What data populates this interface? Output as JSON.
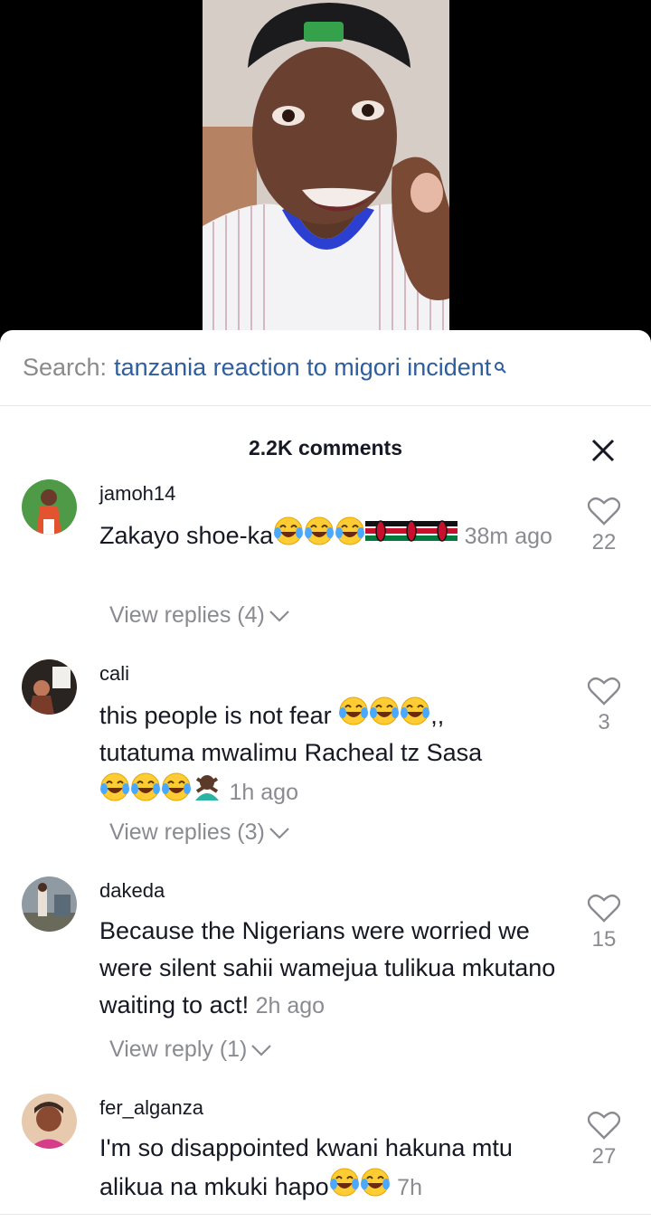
{
  "search": {
    "prefix": "Search:",
    "query": "tanzania reaction to migori incident"
  },
  "comments_header": "2.2K comments",
  "colors": {
    "accent_link": "#2f5e9e",
    "muted": "#8a8b91",
    "text": "#161823"
  },
  "comments": [
    {
      "username": "jamoh14",
      "text": "Zakayo shoe-ka",
      "emojis": [
        "laughing-tears",
        "laughing-tears",
        "laughing-tears",
        "kenya-flag",
        "kenya-flag",
        "kenya-flag"
      ],
      "time": "38m ago",
      "likes": "22",
      "replies_label": "View replies (4)"
    },
    {
      "username": "cali",
      "text_line1": "this people is not fear",
      "text_line1_suffix": ",,",
      "text_line2": "tutatuma mwalimu Racheal tz Sasa",
      "emojis_line1": [
        "laughing-tears",
        "laughing-tears",
        "laughing-tears"
      ],
      "emojis_line3": [
        "laughing-tears",
        "laughing-tears",
        "laughing-tears",
        "person-gesturing-no"
      ],
      "time": "1h ago",
      "likes": "3",
      "replies_label": "View replies (3)"
    },
    {
      "username": "dakeda",
      "text": "Because the Nigerians were worried we were silent sahii wamejua tulikua mkutano waiting to act!",
      "time": "2h ago",
      "likes": "15",
      "replies_label": "View reply (1)"
    },
    {
      "username": "fer_alganza",
      "text": "I'm so disappointed kwani hakuna mtu alikua na mkuki hapo",
      "emojis": [
        "laughing-tears",
        "laughing-tears"
      ],
      "time": "7h",
      "likes": "27"
    }
  ]
}
